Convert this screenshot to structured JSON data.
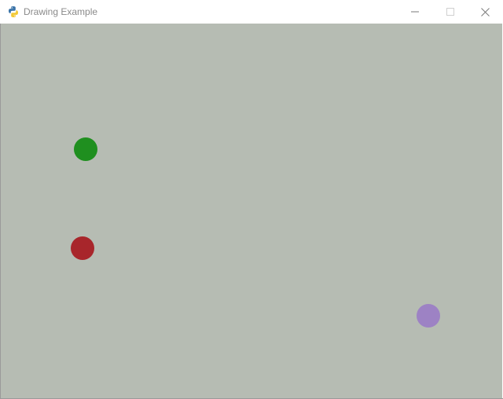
{
  "window": {
    "title": "Drawing Example",
    "app_icon": "python-icon",
    "controls": [
      "minimize-icon",
      "maximize-icon",
      "close-icon"
    ]
  },
  "canvas": {
    "background": "#b6bcb3",
    "dots": [
      {
        "name": "green-dot",
        "color": "#1f8f1f"
      },
      {
        "name": "red-dot",
        "color": "#a8262b"
      },
      {
        "name": "purple-dot",
        "color": "#9d82c4"
      }
    ]
  }
}
